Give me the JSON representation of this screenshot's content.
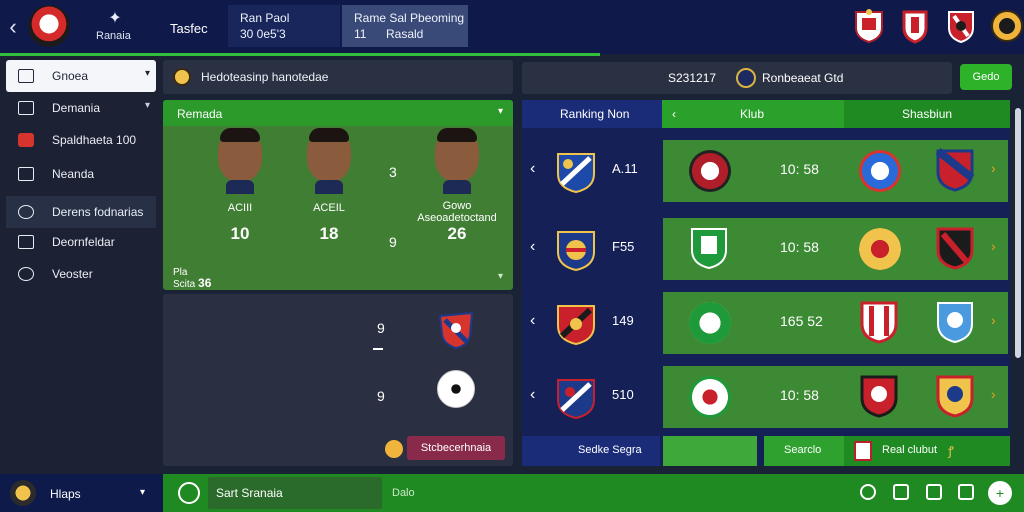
{
  "topbar": {
    "back": "‹",
    "brand_text": "Ranaia",
    "tab": "Tasfec",
    "match1": {
      "line1": "Ran Paol",
      "line2": "30 0e5'3"
    },
    "match2": {
      "line1": "Rame Sal Pbeoming",
      "line2_num": "11",
      "line2_txt": "Rasald"
    }
  },
  "sidebar": {
    "items": [
      {
        "label": "Gnoea",
        "icon": "window-icon"
      },
      {
        "label": "Demania",
        "icon": "square-icon"
      },
      {
        "label": "Spaldhaeta 100",
        "icon": "flag-icon"
      },
      {
        "label": "Neanda",
        "icon": "square-icon"
      },
      {
        "label": "Derens fodnarias",
        "icon": "globe-icon"
      },
      {
        "label": "Deornfeldar",
        "icon": "bookmark-icon"
      },
      {
        "label": "Veoster",
        "icon": "speech-icon"
      }
    ]
  },
  "middle_header": {
    "title": "Hedoteasinp hanotedae"
  },
  "squad": {
    "title": "Remada",
    "players": [
      {
        "name": "ACIII",
        "number": "10"
      },
      {
        "name": "ACEIL",
        "number": "18"
      },
      {
        "name": "Gowo\nAseoadetoctand",
        "number": "26"
      }
    ],
    "middle_num_top": "3",
    "middle_num_bottom": "9",
    "footer_top": "Pla",
    "footer_bottom": "Scita",
    "footer_num": "36"
  },
  "lower": {
    "num1": "9",
    "num2": "9",
    "tag": "Stcbecerhnaia"
  },
  "right_header": {
    "score": "S231217",
    "name": "Ronbeaeat Gtd",
    "button": "Gedo"
  },
  "fixtures": {
    "headers": [
      "Ranking Non",
      "Klub",
      "Shasbiun"
    ],
    "rows": [
      {
        "value": "A.11",
        "time": "10: 58"
      },
      {
        "value": "F55",
        "time": "10: 58"
      },
      {
        "value": "149",
        "time": "165 52"
      },
      {
        "value": "510",
        "time": "10: 58"
      }
    ],
    "footer_left": "Sedke Segra",
    "footer_mid": "Searclo",
    "footer_right": "Real clubut",
    "footer_right_icon": "ꝭ"
  },
  "bottombar": {
    "label": "Hlaps",
    "search": "Sart Sranaia",
    "extra": "Dalo"
  },
  "colors": {
    "navy": "#0f1a4a",
    "green": "#2db22a",
    "dark_panel": "#2a3142",
    "accent_red": "#d8342e"
  }
}
